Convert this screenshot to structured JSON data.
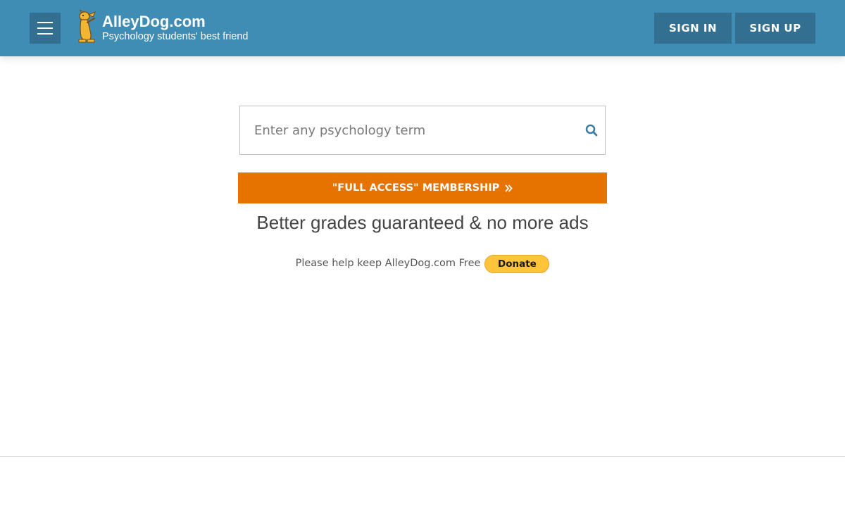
{
  "header": {
    "site_name": "AlleyDog.com",
    "tagline": "Psychology students' best friend",
    "sign_in": "SIGN IN",
    "sign_up": "SIGN UP",
    "icons": {
      "menu": "hamburger-menu-icon",
      "logo": "dog-logo-icon"
    }
  },
  "search": {
    "value": "",
    "placeholder": "Enter any psychology term",
    "icon": "search-icon"
  },
  "membership": {
    "label": "\"FULL ACCESS\" MEMBERSHIP",
    "icon": "double-chevron-right-icon"
  },
  "promo": {
    "text": "Better grades guaranteed & no more ads"
  },
  "donate": {
    "text": "Please help keep AlleyDog.com Free",
    "button": "Donate"
  },
  "colors": {
    "header_bg": "#3f8db5",
    "header_button_bg": "#336f90",
    "membership_bg": "#e67300",
    "donate_bg": "#ffc439",
    "search_icon": "#3f7ea0"
  }
}
